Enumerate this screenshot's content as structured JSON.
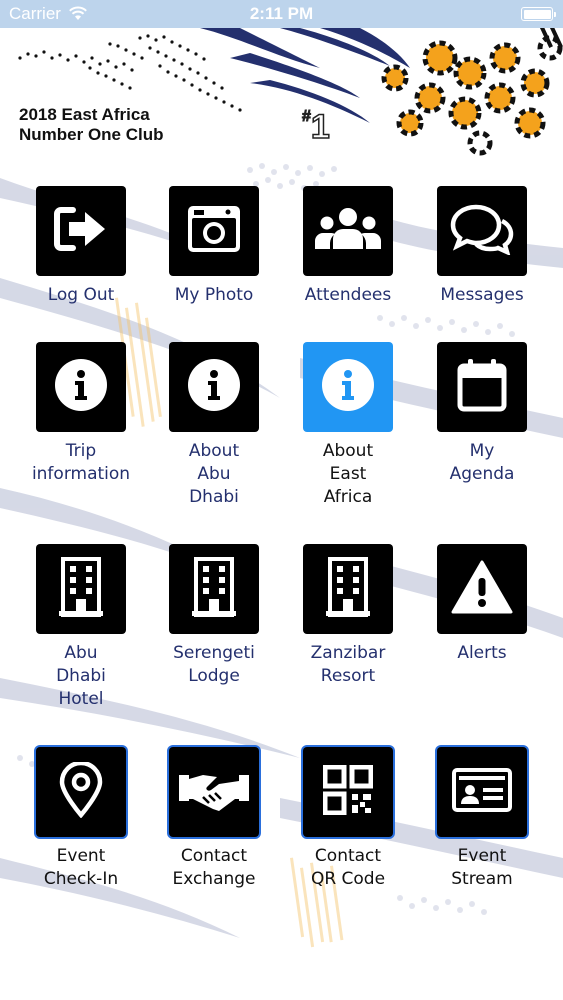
{
  "status_bar": {
    "carrier": "Carrier",
    "time": "2:11 PM"
  },
  "header": {
    "title_line1": "2018 East Africa",
    "title_line2": "Number One Club",
    "rank_hash": "#",
    "rank_number": "1"
  },
  "colors": {
    "tile_bg": "#000000",
    "tile_active_bg": "#2196f3",
    "label_text": "#24306e",
    "status_bar_bg": "#bdd4ec",
    "accent_orange": "#f4a21c",
    "zebra_blue": "#24306e"
  },
  "tiles": [
    {
      "id": "logout",
      "label_lines": [
        "Log Out"
      ],
      "icon": "sign-out-icon"
    },
    {
      "id": "myphoto",
      "label_lines": [
        "My Photo"
      ],
      "icon": "camera-icon"
    },
    {
      "id": "attendees",
      "label_lines": [
        "Attendees"
      ],
      "icon": "users-icon"
    },
    {
      "id": "messages",
      "label_lines": [
        "Messages"
      ],
      "icon": "chat-bubbles-icon"
    },
    {
      "id": "tripinfo",
      "label_lines": [
        "Trip",
        "information"
      ],
      "icon": "info-icon"
    },
    {
      "id": "aboutabudhabi",
      "label_lines": [
        "About",
        "Abu",
        "Dhabi"
      ],
      "icon": "info-icon"
    },
    {
      "id": "abouteastafrica",
      "label_lines": [
        "About",
        "East",
        "Africa"
      ],
      "icon": "info-icon",
      "active": true
    },
    {
      "id": "myagenda",
      "label_lines": [
        "My",
        "Agenda"
      ],
      "icon": "calendar-icon"
    },
    {
      "id": "abudhabihotel",
      "label_lines": [
        "Abu",
        "Dhabi",
        "Hotel"
      ],
      "icon": "building-icon"
    },
    {
      "id": "serengetilodge",
      "label_lines": [
        "Serengeti",
        "Lodge"
      ],
      "icon": "building-icon"
    },
    {
      "id": "zanzibarresort",
      "label_lines": [
        "Zanzibar",
        "Resort"
      ],
      "icon": "building-icon"
    },
    {
      "id": "alerts",
      "label_lines": [
        "Alerts"
      ],
      "icon": "warning-icon"
    },
    {
      "id": "eventcheckin",
      "label_lines": [
        "Event",
        "Check-In"
      ],
      "icon": "map-pin-icon"
    },
    {
      "id": "contactexchange",
      "label_lines": [
        "Contact",
        "Exchange"
      ],
      "icon": "handshake-icon"
    },
    {
      "id": "contactqr",
      "label_lines": [
        "Contact",
        "QR Code"
      ],
      "icon": "qr-code-icon"
    },
    {
      "id": "eventstream",
      "label_lines": [
        "Event",
        "Stream"
      ],
      "icon": "id-card-icon"
    }
  ]
}
